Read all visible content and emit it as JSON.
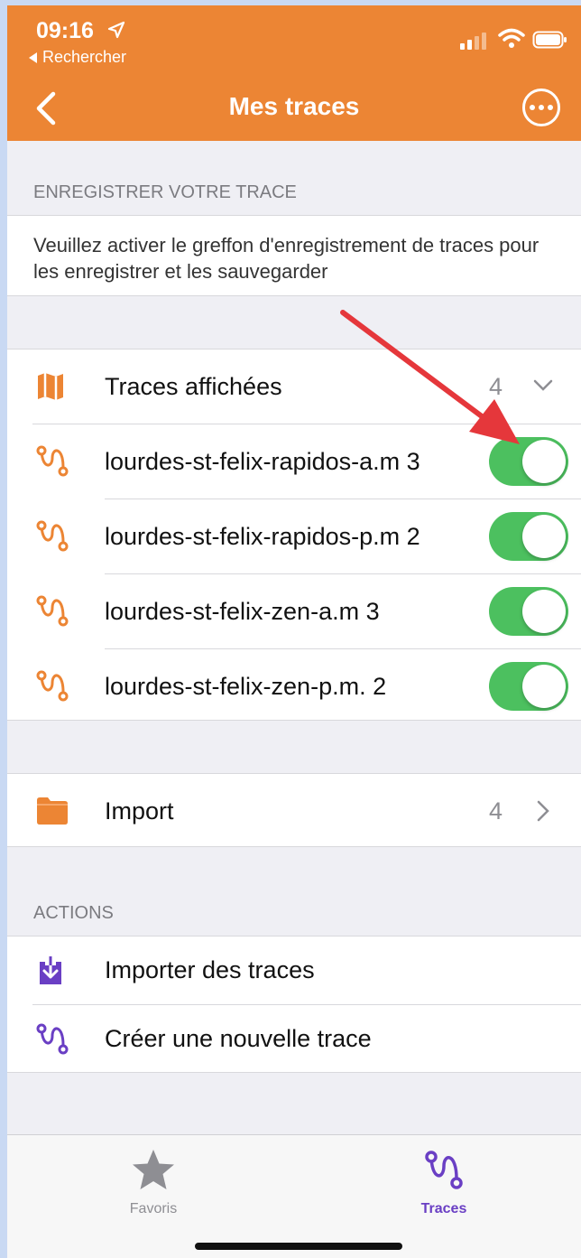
{
  "status_bar": {
    "time": "09:16",
    "back_app": "Rechercher"
  },
  "nav": {
    "title": "Mes traces"
  },
  "record_section": {
    "header": "ENREGISTRER VOTRE TRACE",
    "notice": "Veuillez activer le greffon d'enregistrement de traces pour les enregistrer et les sauvegarder"
  },
  "displayed": {
    "label": "Traces affichées",
    "count": "4",
    "tracks": [
      {
        "name": "lourdes-st-felix-rapidos-a.m 3",
        "enabled": true
      },
      {
        "name": "lourdes-st-felix-rapidos-p.m 2",
        "enabled": true
      },
      {
        "name": "lourdes-st-felix-zen-a.m 3",
        "enabled": true
      },
      {
        "name": "lourdes-st-felix-zen-p.m. 2",
        "enabled": true
      }
    ]
  },
  "import": {
    "label": "Import",
    "count": "4"
  },
  "actions": {
    "header": "ACTIONS",
    "items": [
      {
        "label": "Importer des traces",
        "icon": "import-download-icon"
      },
      {
        "label": "Créer une nouvelle trace",
        "icon": "route-icon"
      }
    ]
  },
  "tabbar": {
    "tabs": [
      {
        "label": "Favoris",
        "icon": "star-icon",
        "active": false
      },
      {
        "label": "Traces",
        "icon": "route-icon",
        "active": true
      }
    ]
  },
  "colors": {
    "header": "#ec8534",
    "accent_orange": "#ec8534",
    "toggle_on": "#4cc05f",
    "active_tab": "#6a3fc4",
    "annotation_arrow": "#e5373b"
  }
}
